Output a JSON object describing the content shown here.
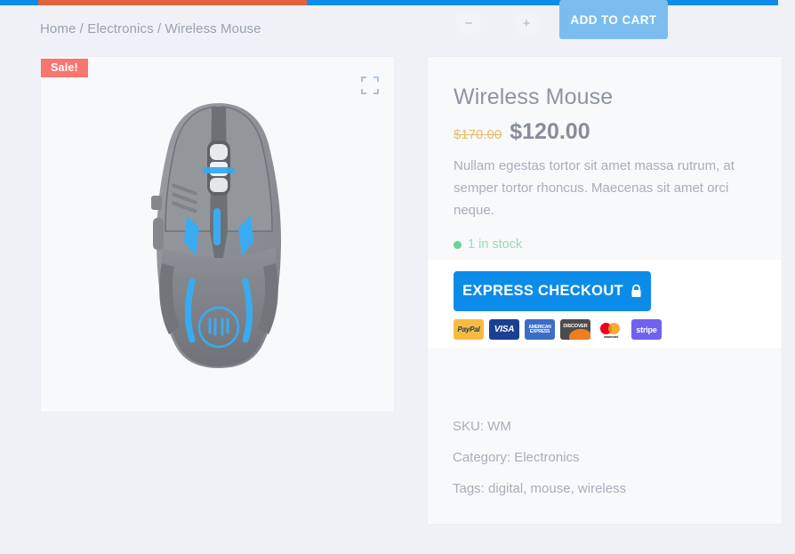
{
  "topbar": {
    "segments": [
      {
        "name": "blue-left",
        "color": "#0d8ce8"
      },
      {
        "name": "orange",
        "color": "#e4603c"
      },
      {
        "name": "blue-right",
        "color": "#0d8ce8"
      }
    ]
  },
  "breadcrumb": {
    "text": "Home / Electronics / Wireless Mouse",
    "items": [
      "Home",
      "Electronics",
      "Wireless Mouse"
    ],
    "separator": "/"
  },
  "gallery": {
    "sale_badge": "Sale!",
    "expand_icon": "expand-icon",
    "image_alt": "Wireless gaming mouse, gray body with blue LED accents"
  },
  "product": {
    "title": "Wireless Mouse",
    "price_old": "$170.00",
    "price_new": "$120.00",
    "description": "Nullam egestas tortor sit amet massa rutrum, at semper tortor rhoncus. Maecenas sit amet orci neque.",
    "stock": "1 in stock",
    "sku_line": "SKU: WM",
    "category_line": "Category: Electronics",
    "tags_line": "Tags: digital, mouse, wireless"
  },
  "express": {
    "button_label": "EXPRESS CHECKOUT",
    "lock_icon": "lock-icon",
    "payment_methods": [
      {
        "name": "paypal",
        "label": "PayPal",
        "bg": "#f7bc3e",
        "fg": "#1c3668"
      },
      {
        "name": "visa",
        "label": "VISA",
        "bg": "#1c3f8f",
        "fg": "#ffffff"
      },
      {
        "name": "american-express",
        "label": "AMERICAN EXPRESS",
        "bg": "#3b6ec8",
        "fg": "#ffffff"
      },
      {
        "name": "discover",
        "label": "DISCOVER",
        "bg": "#4c4c4c",
        "fg": "#ffffff"
      },
      {
        "name": "mastercard",
        "label": "mastercard",
        "bg": "#ffffff",
        "fg": "#231f20"
      },
      {
        "name": "stripe",
        "label": "stripe",
        "bg": "#6f62ee",
        "fg": "#ffffff"
      }
    ]
  },
  "cart": {
    "minus_label": "−",
    "plus_label": "+",
    "quantity_value": "",
    "quantity_placeholder": "",
    "add_to_cart_label": "ADD TO CART"
  },
  "colors": {
    "page_bg": "#eff1f6",
    "card_bg": "#f8f9fb",
    "accent_blue": "#0c8ce9",
    "accent_orange": "#e4603c",
    "sale_badge": "#f8766f",
    "add_to_cart": "#7cbdef",
    "stock_green": "#6fcf97",
    "price_old": "#e7bd6a"
  }
}
